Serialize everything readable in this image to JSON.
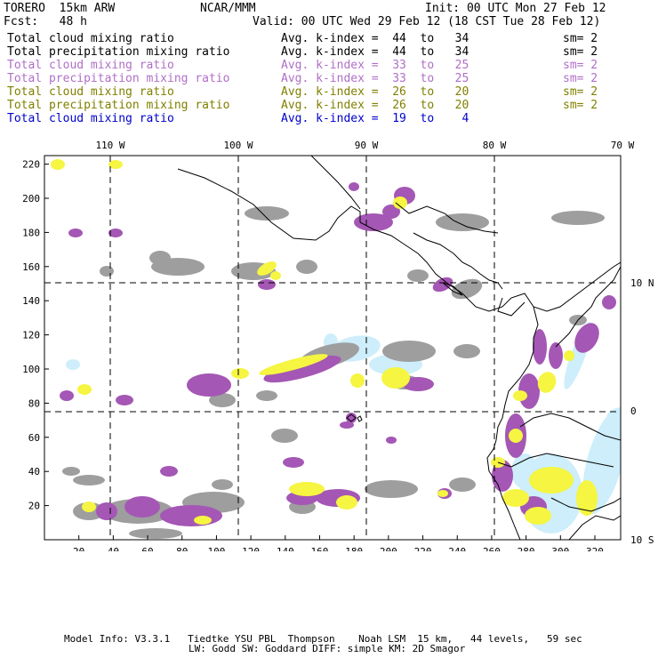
{
  "header": {
    "model": "TORERO  15km ARW",
    "org": "NCAR/MMM",
    "init": "Init: 00 UTC Mon 27 Feb 12",
    "fcst": "Fcst:   48 h",
    "valid": "Valid: 00 UTC Wed 29 Feb 12 (18 CST Tue 28 Feb 12)"
  },
  "legend": [
    {
      "name": "Total cloud mixing ratio",
      "kindex": "Avg. k-index =  44  to   34",
      "sm": "sm= 2",
      "color": "#000000"
    },
    {
      "name": "Total precipitation mixing ratio",
      "kindex": "Avg. k-index =  44  to   34",
      "sm": "sm= 2",
      "color": "#000000"
    },
    {
      "name": "Total cloud mixing ratio",
      "kindex": "Avg. k-index =  33  to   25",
      "sm": "sm= 2",
      "color": "#b06fc8"
    },
    {
      "name": "Total precipitation mixing ratio",
      "kindex": "Avg. k-index =  33  to   25",
      "sm": "sm= 2",
      "color": "#b06fc8"
    },
    {
      "name": "Total cloud mixing ratio",
      "kindex": "Avg. k-index =  26  to   20",
      "sm": "sm= 2",
      "color": "#808000"
    },
    {
      "name": "Total precipitation mixing ratio",
      "kindex": "Avg. k-index =  26  to   20",
      "sm": "sm= 2",
      "color": "#808000"
    },
    {
      "name": "Total cloud mixing ratio",
      "kindex": "Avg. k-index =  19  to    4",
      "sm": "",
      "color": "#0000cc"
    }
  ],
  "map": {
    "top_lon_labels": [
      "110 W",
      "100 W",
      "90 W",
      "80 W",
      "70 W"
    ],
    "right_lat_labels": [
      "10 N",
      "0",
      "10 S"
    ],
    "x_ticks": [
      "20",
      "40",
      "60",
      "80",
      "100",
      "120",
      "140",
      "160",
      "180",
      "200",
      "220",
      "240",
      "260",
      "280",
      "300",
      "320"
    ],
    "y_ticks": [
      "20",
      "40",
      "60",
      "80",
      "100",
      "120",
      "140",
      "160",
      "180",
      "200",
      "220"
    ],
    "x_grid_range": [
      0,
      335
    ],
    "y_grid_range": [
      0,
      225
    ],
    "colors": {
      "gray": "#9e9e9e",
      "purple": "#a457b4",
      "yellow": "#f5f542",
      "lightblue": "#cdeefa",
      "coast": "#000000"
    }
  },
  "footer": {
    "line1": "Model Info: V3.3.1   Tiedtke YSU PBL  Thompson    Noah LSM  15 km,   44 levels,   59 sec",
    "line2": "LW: Godd SW: Goddard DIFF: simple KM: 2D Smagor"
  }
}
